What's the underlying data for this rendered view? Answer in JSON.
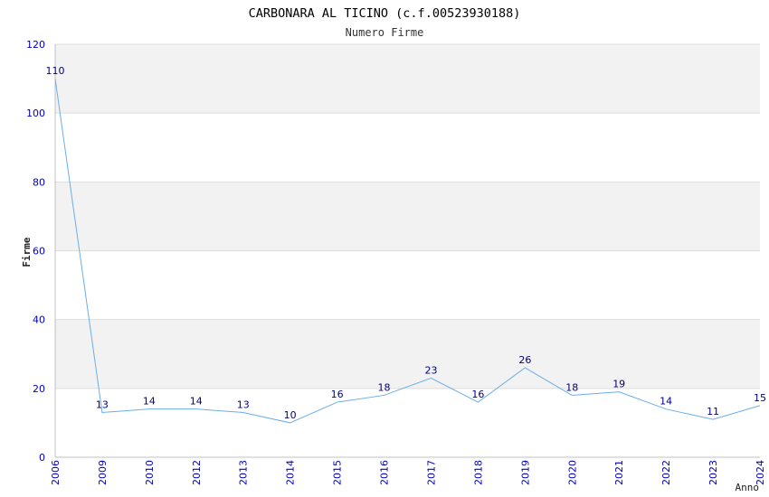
{
  "chart_data": {
    "type": "line",
    "title": "CARBONARA AL TICINO (c.f.00523930188)",
    "subtitle": "Numero Firme",
    "xlabel": "Anno",
    "ylabel": "Firme",
    "categories": [
      "2006",
      "2009",
      "2010",
      "2012",
      "2013",
      "2014",
      "2015",
      "2016",
      "2017",
      "2018",
      "2019",
      "2020",
      "2021",
      "2022",
      "2023",
      "2024"
    ],
    "values": [
      110,
      13,
      14,
      14,
      13,
      10,
      16,
      18,
      23,
      16,
      26,
      18,
      19,
      14,
      11,
      15
    ],
    "ylim": [
      0,
      120
    ],
    "yticks": [
      0,
      20,
      40,
      60,
      80,
      100,
      120
    ],
    "grid": "horizontal bands",
    "colors": {
      "line": "#6aaee8",
      "band": "#f2f2f2",
      "grid": "#dddddd",
      "tick_text": "#0000c0",
      "data_label": "#00007f",
      "axis": "#c0c0c0",
      "title_text": "#000000"
    }
  }
}
